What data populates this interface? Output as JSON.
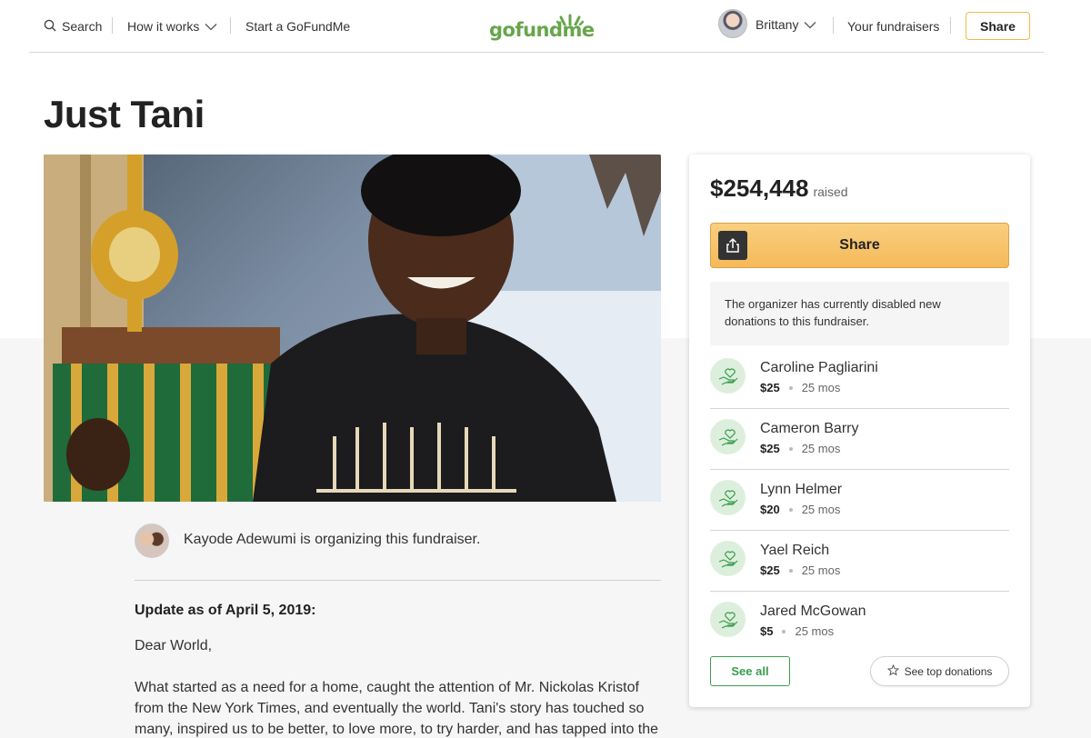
{
  "header": {
    "search_label": "Search",
    "how_it_works_label": "How it works",
    "start_label": "Start a GoFundMe",
    "logo_text": "gofundme",
    "user_name": "Brittany",
    "your_fundraisers_label": "Your fundraisers",
    "share_label": "Share",
    "brand_color": "#66a64a"
  },
  "campaign": {
    "title": "Just Tani",
    "organizer_text": "Kayode Adewumi is organizing this fundraiser."
  },
  "story": {
    "update_heading": "Update as of April 5, 2019:",
    "greeting": "Dear World,",
    "paragraph": "What started as a need for a home, caught the attention of Mr. Nickolas Kristof from the New York Times, and eventually the world. Tani's story has touched so many, inspired us to be better, to love more, to try harder, and has tapped into the good that"
  },
  "panel": {
    "raised_amount": "$254,448",
    "raised_label": "raised",
    "share_label": "Share",
    "notice": "The organizer has currently disabled new donations to this fundraiser.",
    "donors": [
      {
        "name": "Caroline Pagliarini",
        "amount": "$25",
        "time": "25 mos"
      },
      {
        "name": "Cameron Barry",
        "amount": "$25",
        "time": "25 mos"
      },
      {
        "name": "Lynn Helmer",
        "amount": "$20",
        "time": "25 mos"
      },
      {
        "name": "Yael Reich",
        "amount": "$25",
        "time": "25 mos"
      },
      {
        "name": "Jared McGowan",
        "amount": "$5",
        "time": "25 mos"
      }
    ],
    "see_all_label": "See all",
    "see_top_label": "See top donations",
    "accent_color": "#f5b95a",
    "green_color": "#3a9c4e"
  },
  "icons": [
    "search-icon",
    "chevron-down-icon",
    "share-upload-icon",
    "donor-heart-hand-icon",
    "star-icon"
  ]
}
